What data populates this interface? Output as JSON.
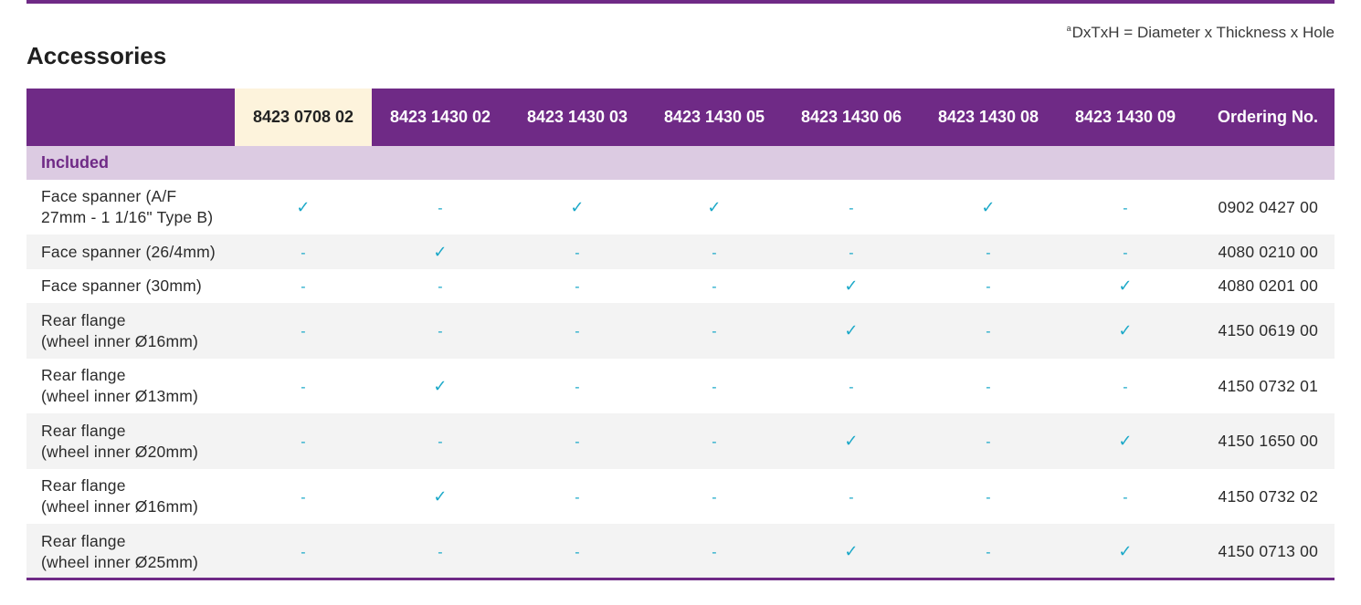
{
  "footnote": {
    "superscript": "a",
    "text": "DxTxH = Diameter x Thickness x Hole"
  },
  "section_title": "Accessories",
  "columns": {
    "first": "",
    "products": [
      "8423 0708 02",
      "8423 1430 02",
      "8423 1430 03",
      "8423 1430 05",
      "8423 1430 06",
      "8423 1430 08",
      "8423 1430 09"
    ],
    "ordering": "Ordering No."
  },
  "group_label": "Included",
  "symbols": {
    "yes": "✓",
    "no": "-"
  },
  "rows": [
    {
      "name": [
        "Face spanner (A/F",
        "27mm - 1 1/16\" Type B)"
      ],
      "marks": [
        "✓",
        "-",
        "✓",
        "✓",
        "-",
        "✓",
        "-"
      ],
      "ordering_no": "0902 0427 00"
    },
    {
      "name": [
        "Face spanner (26/4mm)"
      ],
      "marks": [
        "-",
        "✓",
        "-",
        "-",
        "-",
        "-",
        "-"
      ],
      "ordering_no": "4080 0210 00"
    },
    {
      "name": [
        "Face spanner (30mm)"
      ],
      "marks": [
        "-",
        "-",
        "-",
        "-",
        "✓",
        "-",
        "✓"
      ],
      "ordering_no": "4080 0201 00"
    },
    {
      "name": [
        "Rear flange",
        "(wheel inner Ø16mm)"
      ],
      "marks": [
        "-",
        "-",
        "-",
        "-",
        "✓",
        "-",
        "✓"
      ],
      "ordering_no": "4150 0619 00"
    },
    {
      "name": [
        "Rear flange",
        "(wheel inner Ø13mm)"
      ],
      "marks": [
        "-",
        "✓",
        "-",
        "-",
        "-",
        "-",
        "-"
      ],
      "ordering_no": "4150 0732 01"
    },
    {
      "name": [
        "Rear flange",
        "(wheel inner Ø20mm)"
      ],
      "marks": [
        "-",
        "-",
        "-",
        "-",
        "✓",
        "-",
        "✓"
      ],
      "ordering_no": "4150 1650 00"
    },
    {
      "name": [
        "Rear flange",
        "(wheel inner Ø16mm)"
      ],
      "marks": [
        "-",
        "✓",
        "-",
        "-",
        "-",
        "-",
        "-"
      ],
      "ordering_no": "4150 0732 02"
    },
    {
      "name": [
        "Rear flange",
        "(wheel inner Ø25mm)"
      ],
      "marks": [
        "-",
        "-",
        "-",
        "-",
        "✓",
        "-",
        "✓"
      ],
      "ordering_no": "4150 0713 00"
    }
  ],
  "colors": {
    "accent": "#6f2a86",
    "group_background": "#dccbe2",
    "highlight_header": "#fdf3dc",
    "mark": "#1aa8c8",
    "row_shade": "#f3f3f3"
  }
}
